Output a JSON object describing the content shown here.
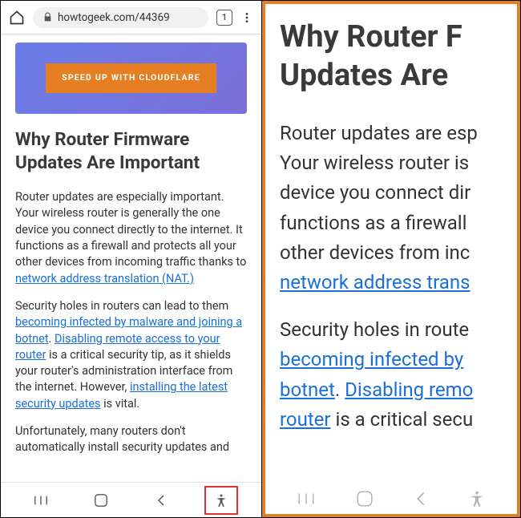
{
  "browser": {
    "url": "howtogeek.com/44369",
    "tab_count": "1"
  },
  "banner": {
    "button_label": "SPEED UP WITH CLOUDFLARE"
  },
  "article": {
    "heading": "Why Router Firmware Updates Are Important",
    "p1_a": "Router updates are especially important. Your wireless router is generally the one device you connect directly to the internet. It functions as a firewall and protects all your other devices from incoming traffic thanks to ",
    "p1_link": "network address translation (NAT.)",
    "p2_a": "Security holes in routers can lead to them ",
    "p2_link1": "becoming infected by malware and joining a botnet",
    "p2_b": ". ",
    "p2_link2": "Disabling remote access to your router",
    "p2_c": " is a critical security tip, as it shields your router's administration interface from the internet. However, ",
    "p2_link3": "installing the latest security updates",
    "p2_d": " is vital.",
    "p3": "Unfortunately, many routers don't automatically install security updates and"
  },
  "zoom": {
    "heading_l1": "Why Router F",
    "heading_l2": "Updates Are",
    "p1_l1": "Router updates are esp",
    "p1_l2": "Your wireless router is",
    "p1_l3": "device you connect dir",
    "p1_l4": "functions as a firewall",
    "p1_l5": "other devices from inc",
    "p1_link": "network address trans",
    "p2_l1": "Security holes in route",
    "p2_link1": "becoming infected by",
    "p2_link2a": "botnet",
    "p2_b": ". ",
    "p2_link2b": "Disabling remo",
    "p2_link3": "router",
    "p2_c": " is a critical secu"
  }
}
